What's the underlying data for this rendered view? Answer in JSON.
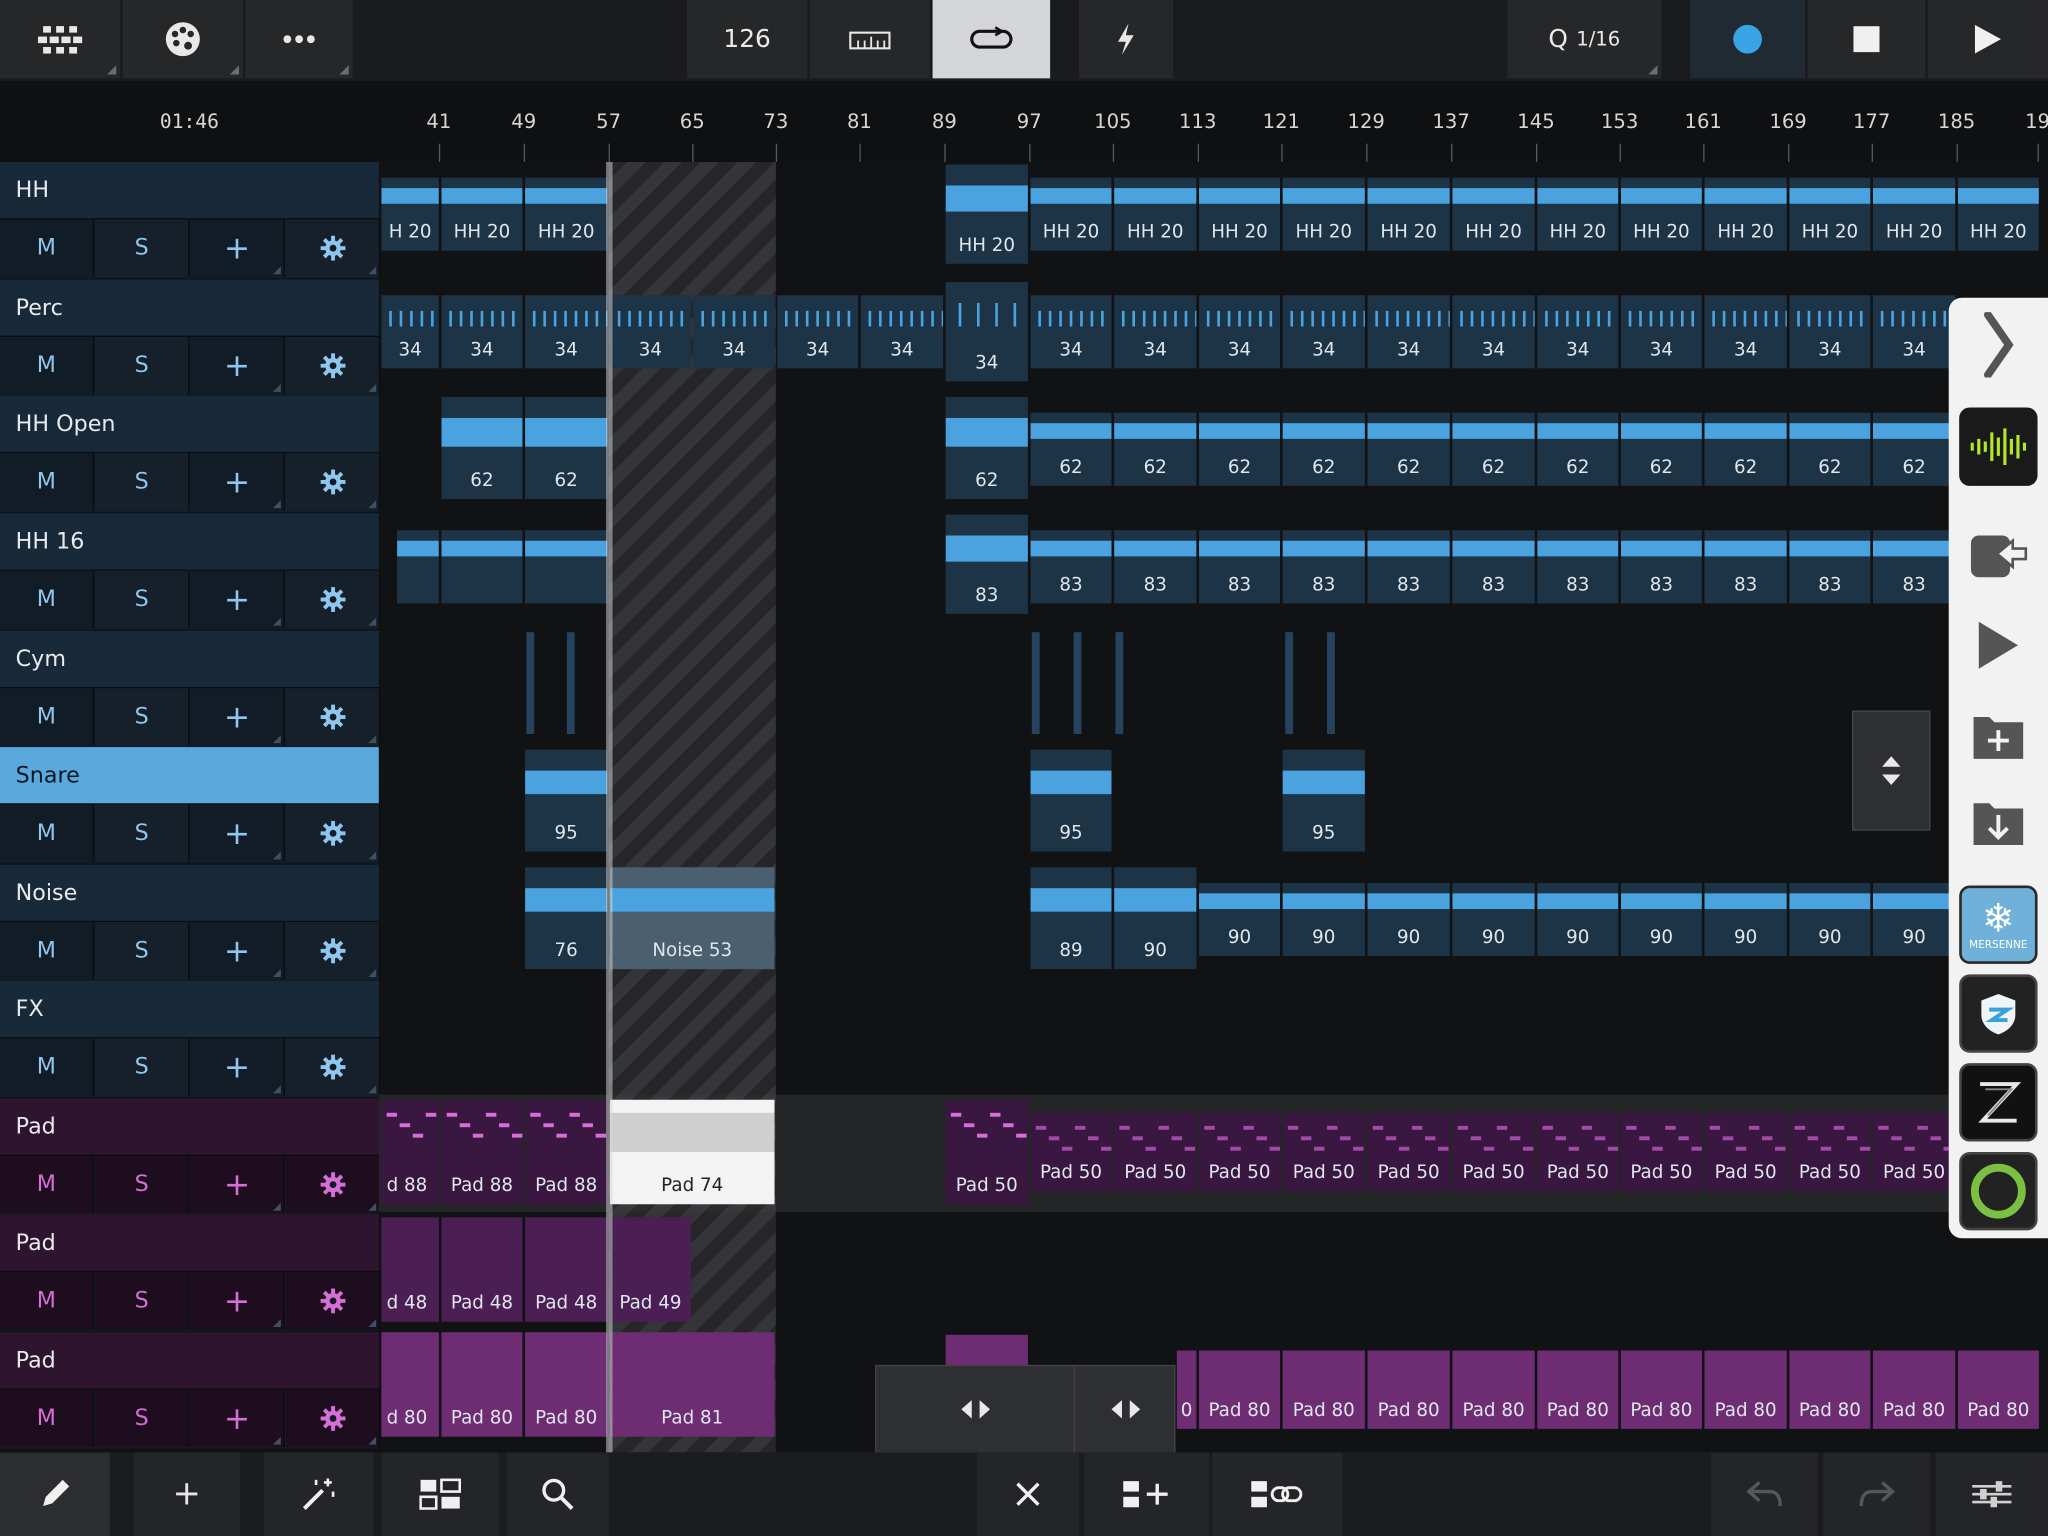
{
  "toolbar": {
    "tempo": "126",
    "quantize_q": "Q",
    "quantize_value": "1/16"
  },
  "ruler": {
    "time": "01:46",
    "bars": [
      "41",
      "49",
      "57",
      "65",
      "73",
      "81",
      "89",
      "97",
      "105",
      "113",
      "121",
      "129",
      "137",
      "145",
      "153",
      "161",
      "169",
      "177",
      "185",
      "19"
    ]
  },
  "tracks": [
    {
      "name": "HH",
      "mute": "M",
      "solo": "S",
      "color": "blue"
    },
    {
      "name": "Perc",
      "mute": "M",
      "solo": "S",
      "color": "blue"
    },
    {
      "name": "HH Open",
      "mute": "M",
      "solo": "S",
      "color": "blue"
    },
    {
      "name": "HH 16",
      "mute": "M",
      "solo": "S",
      "color": "blue"
    },
    {
      "name": "Cym",
      "mute": "M",
      "solo": "S",
      "color": "blue"
    },
    {
      "name": "Snare",
      "mute": "M",
      "solo": "S",
      "color": "blue",
      "selected": true
    },
    {
      "name": "Noise",
      "mute": "M",
      "solo": "S",
      "color": "blue"
    },
    {
      "name": "FX",
      "mute": "M",
      "solo": "S",
      "color": "blue"
    },
    {
      "name": "Pad",
      "mute": "M",
      "solo": "S",
      "color": "pink"
    },
    {
      "name": "Pad",
      "mute": "M",
      "solo": "S",
      "color": "pink"
    },
    {
      "name": "Pad",
      "mute": "M",
      "solo": "S",
      "color": "pink"
    }
  ],
  "clip_labels": {
    "hh_first": "H 20",
    "hh": "HH 20",
    "perc": "34",
    "hh_open": "62",
    "hh16": "83",
    "snare": "95",
    "noise_a": "76",
    "noise_b": "Noise 53",
    "noise_c": "89",
    "noise_d": "90",
    "noise_e": "90",
    "pad1_first": "d 88",
    "pad1_a": "Pad 88",
    "pad1_sel": "Pad 74",
    "pad1_b": "Pad 50",
    "pad2_first": "d 48",
    "pad2_a": "Pad 48",
    "pad2_b": "Pad 49",
    "pad3_first": "d 80",
    "pad3_a": "Pad 80",
    "pad3_b": "Pad 81",
    "pad3_cut": "0"
  },
  "right_panel": {
    "icons": [
      "chevron-right-icon",
      "waveform-app-icon",
      "export-icon",
      "play-icon",
      "add-folder-icon",
      "download-folder-icon",
      "mersenne-app-icon",
      "shield-app-icon",
      "z-app-icon",
      "ring-app-icon"
    ],
    "mersenne_label": "MERSENNE"
  },
  "colors": {
    "blue": "#4aa3df",
    "pink": "#d56fd6",
    "selected_track": "#5aa9dd",
    "record": "#3aa3e6"
  }
}
